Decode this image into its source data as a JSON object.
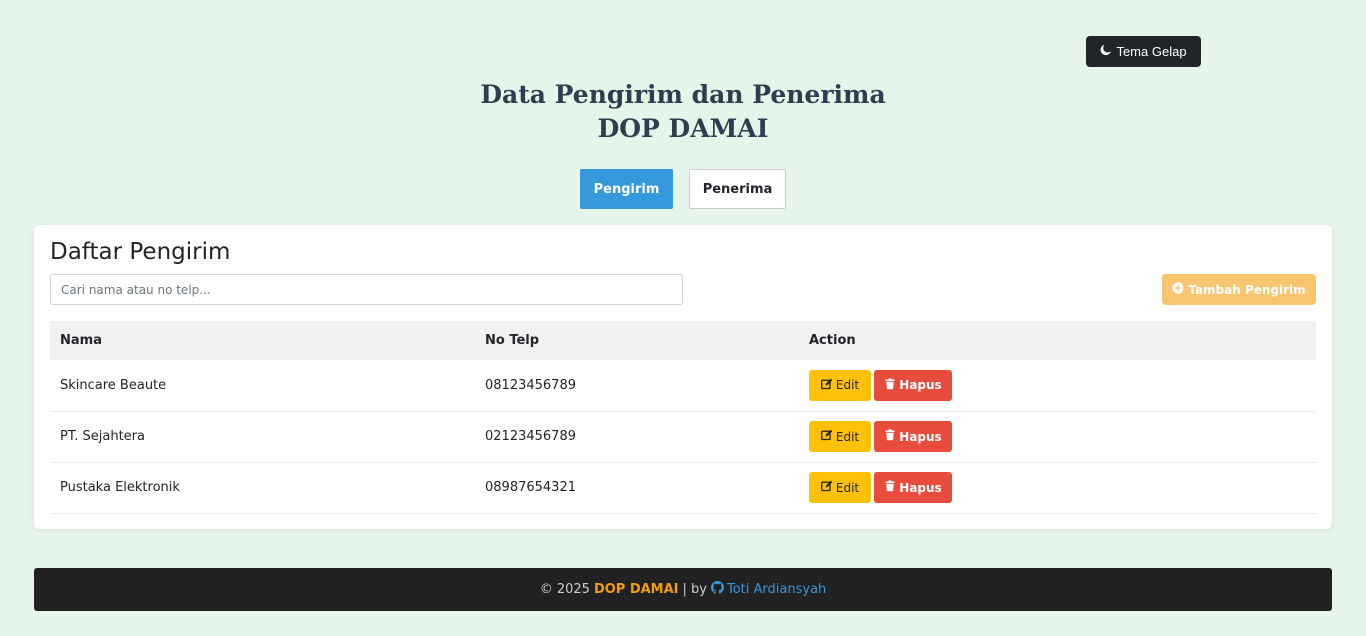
{
  "theme_button": {
    "label": "Tema Gelap",
    "icon": "moon-icon"
  },
  "title": {
    "line1": "Data Pengirim dan Penerima",
    "line2": "DOP DAMAI"
  },
  "tabs": [
    {
      "label": "Pengirim",
      "active": true
    },
    {
      "label": "Penerima",
      "active": false
    }
  ],
  "card": {
    "title": "Daftar Pengirim",
    "search_placeholder": "Cari nama atau no telp...",
    "add_button": "Tambah Pengirim",
    "table": {
      "headers": [
        "Nama",
        "No Telp",
        "Action"
      ],
      "rows": [
        {
          "nama": "Skincare Beaute",
          "telp": "08123456789"
        },
        {
          "nama": "PT. Sejahtera",
          "telp": "02123456789"
        },
        {
          "nama": "Pustaka Elektronik",
          "telp": "08987654321"
        }
      ],
      "edit_label": "Edit",
      "delete_label": "Hapus"
    }
  },
  "footer": {
    "copyright": "© 2025",
    "brand": "DOP DAMAI",
    "separator": "| by",
    "author": "Toti Ardiansyah"
  },
  "colors": {
    "background": "#e6f5e9",
    "primary": "#3498db",
    "warning": "#ffc107",
    "danger": "#e74c3c",
    "add_button": "#f7c46f",
    "footer_bg": "#212121",
    "brand_accent": "#f39c12"
  }
}
